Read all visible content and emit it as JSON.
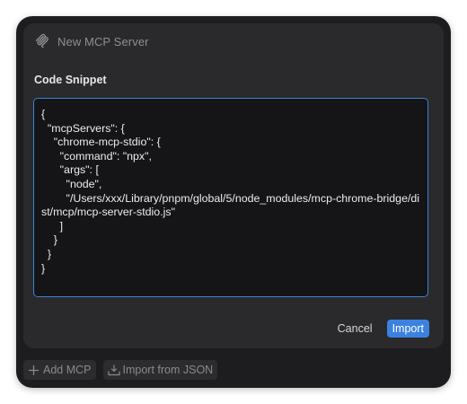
{
  "dialog": {
    "title": "New MCP Server",
    "icon": "mcp-logo-icon",
    "field_label": "Code Snippet",
    "code": "{\n  \"mcpServers\": {\n    \"chrome-mcp-stdio\": {\n      \"command\": \"npx\",\n      \"args\": [\n        \"node\",\n        \"/Users/xxx/Library/pnpm/global/5/node_modules/mcp-chrome-bridge/dist/mcp/mcp-server-stdio.js\"\n      ]\n    }\n  }\n}",
    "cancel_label": "Cancel",
    "import_label": "Import"
  },
  "footer": {
    "add_mcp_label": "Add MCP",
    "add_mcp_icon": "plus-icon",
    "import_json_label": "Import from JSON",
    "import_json_icon": "import-tray-icon"
  },
  "colors": {
    "window_bg": "#1d1d1f",
    "dialog_bg": "#2a2a2c",
    "code_bg": "#151517",
    "focus_border": "#3b82d6",
    "primary_button": "#3b82e0"
  }
}
